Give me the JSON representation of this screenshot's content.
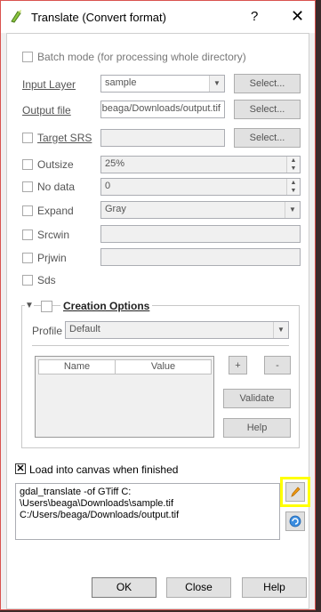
{
  "window": {
    "title": "Translate (Convert format)",
    "help_glyph": "?",
    "close_glyph": "✕"
  },
  "batch_mode": {
    "label": "Batch mode (for processing whole directory)",
    "checked": false
  },
  "input_layer": {
    "label": "Input Layer",
    "value": "sample",
    "button": "Select..."
  },
  "output_file": {
    "label": "Output file",
    "value": "beaga/Downloads/output.tif",
    "button": "Select..."
  },
  "target_srs": {
    "label": "Target SRS",
    "value": "",
    "button": "Select..."
  },
  "outsize": {
    "label": "Outsize",
    "value": "25%"
  },
  "nodata": {
    "label": "No data",
    "value": "0"
  },
  "expand": {
    "label": "Expand",
    "value": "Gray"
  },
  "srcwin": {
    "label": "Srcwin",
    "value": ""
  },
  "prjwin": {
    "label": "Prjwin",
    "value": ""
  },
  "sds": {
    "label": "Sds"
  },
  "creation_options": {
    "label": "Creation Options",
    "profile_label": "Profile",
    "profile_value": "Default",
    "columns": [
      "Name",
      "Value"
    ],
    "add_button": "+",
    "remove_button": "-",
    "validate_button": "Validate",
    "help_button": "Help"
  },
  "load_into_canvas": {
    "label": "Load into canvas when finished",
    "checked": true
  },
  "command": "gdal_translate -of GTiff C:\n\\Users\\beaga\\Downloads\\sample.tif\nC:/Users/beaga/Downloads/output.tif",
  "highlight_color": "#ffff00",
  "footer": {
    "ok": "OK",
    "close": "Close",
    "help": "Help"
  }
}
